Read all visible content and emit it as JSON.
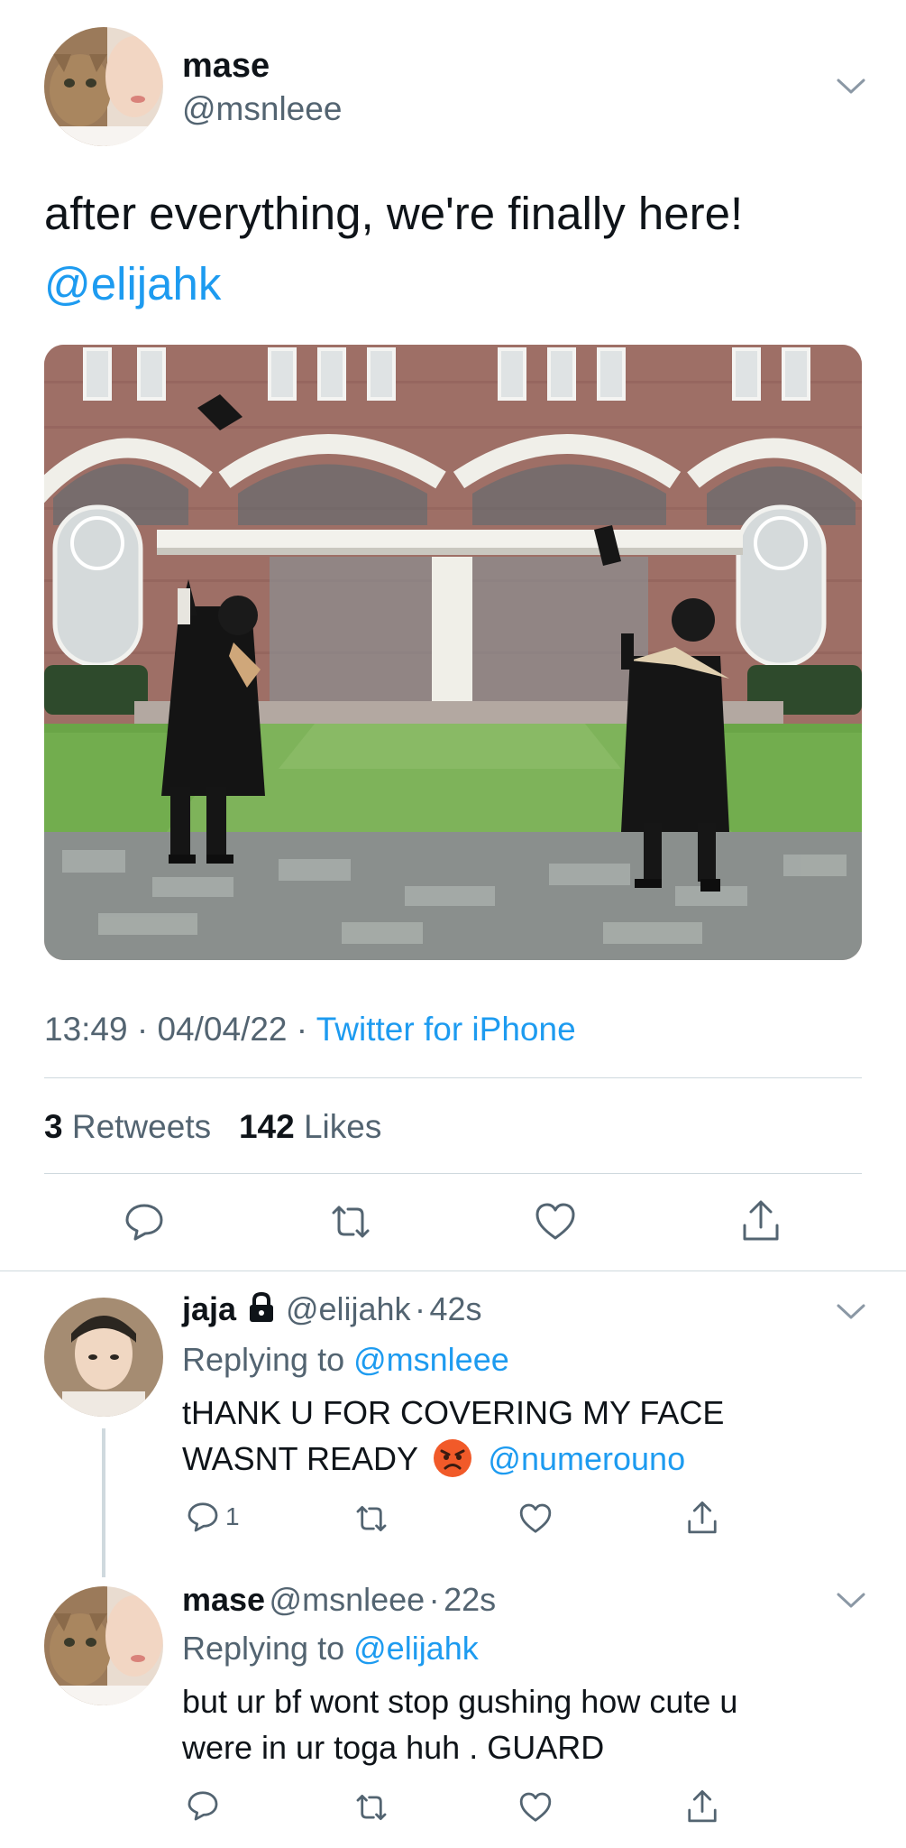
{
  "main_tweet": {
    "display_name": "mase",
    "handle": "@msnleee",
    "text": "after everything, we're finally here!",
    "mention": "@elijahk",
    "time": "13:49",
    "date": "04/04/22",
    "source": "Twitter for iPhone",
    "retweets_count": "3",
    "retweets_label": "Retweets",
    "likes_count": "142",
    "likes_label": "Likes",
    "avatar_icon": "cat-avatar-icon",
    "photo_icon": "graduation-photo"
  },
  "replies": [
    {
      "display_name": "jaja",
      "locked_icon": "lock-icon",
      "handle": "@elijahk",
      "age": "42s",
      "replying_label": "Replying to",
      "replying_to": "@msnleee",
      "text_line1": "tHANK U FOR COVERING MY FACE",
      "text_line2": "WASNT READY",
      "emoji": "😡",
      "mention": "@numerouno",
      "reply_count": "1"
    },
    {
      "display_name": "mase",
      "handle": "@msnleee",
      "age": "22s",
      "replying_label": "Replying to",
      "replying_to": "@elijahk",
      "text_line1": "but ur bf wont stop gushing how cute u",
      "text_line2": "were in ur toga huh . GUARD"
    }
  ],
  "colors": {
    "accent": "#1d9bf0",
    "secondary_text": "#536471",
    "divider": "#cfd9de"
  }
}
